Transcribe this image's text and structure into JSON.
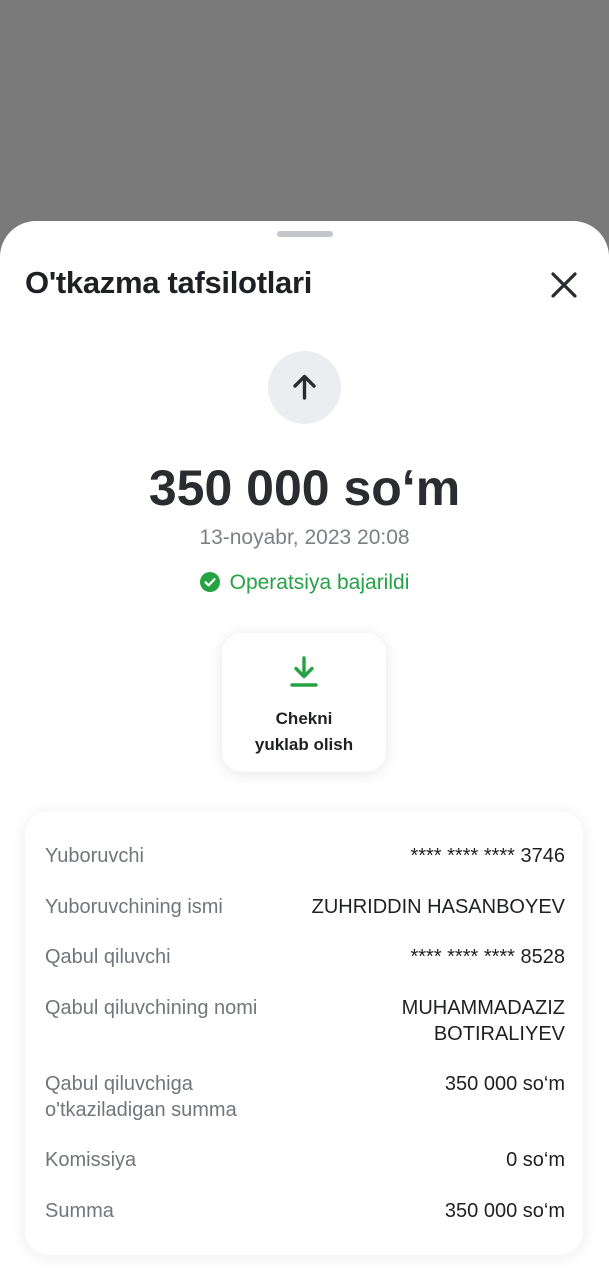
{
  "sheet": {
    "title": "O'tkazma tafsilotlari",
    "amount": "350 000 so‘m",
    "datetime": "13-noyabr, 2023 20:08",
    "status": "Operatsiya bajarildi",
    "receipt_button": {
      "line1": "Chekni",
      "line2": "yuklab olish"
    },
    "icons": {
      "close": "close-icon",
      "direction": "arrow-up-icon",
      "status": "check-circle-icon",
      "download": "download-icon"
    },
    "colors": {
      "success": "#25a244",
      "text": "#1f2023",
      "muted": "#72757c"
    }
  },
  "details": [
    {
      "label": "Yuboruvchi",
      "value": "**** **** **** 3746"
    },
    {
      "label": "Yuboruvchining ismi",
      "value": "ZUHRIDDIN HASANBOYEV"
    },
    {
      "label": "Qabul qiluvchi",
      "value": "**** **** **** 8528"
    },
    {
      "label": "Qabul qiluvchining nomi",
      "value_line1": "MUHAMMADAZIZ",
      "value_line2": "BOTIRALIYEV"
    },
    {
      "label_line1": "Qabul qiluvchiga",
      "label_line2": "o'tkaziladigan summa",
      "value": "350 000 so‘m"
    },
    {
      "label": "Komissiya",
      "value": "0 so‘m"
    },
    {
      "label": "Summa",
      "value": "350 000 so‘m"
    }
  ]
}
